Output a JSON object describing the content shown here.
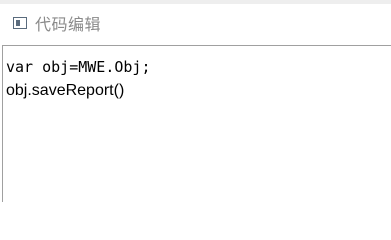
{
  "window": {
    "title": "代码编辑",
    "icon": "code-window-icon"
  },
  "editor": {
    "lines": [
      "var obj=MWE.Obj;",
      "obj.saveReport()"
    ]
  }
}
